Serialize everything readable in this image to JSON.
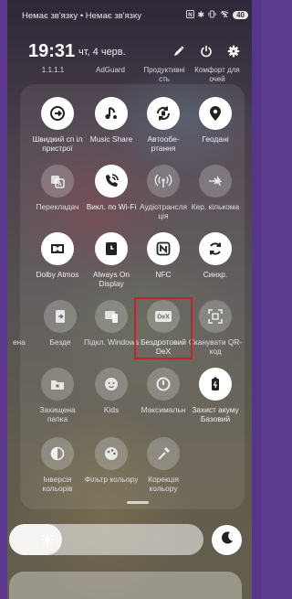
{
  "status_bar": {
    "carrier": "Немає зв'язку • Немає зв'язку",
    "battery": "40",
    "icons": [
      "nfc-icon",
      "bluetooth-icon",
      "vibrate-icon",
      "wifi-off-icon"
    ]
  },
  "header": {
    "time": "19:31",
    "date": "чт, 4 черв.",
    "icons": [
      "pencil-icon",
      "power-icon",
      "gear-icon"
    ]
  },
  "top_partial_labels": [
    "1.1.1.1",
    "AdGuard",
    "Продуктивні сть",
    "Комфорт для очей"
  ],
  "tiles": [
    {
      "label": "Швидкий сп іл пристрої",
      "state": "on",
      "icon": "quick-share-icon"
    },
    {
      "label": "Music Share",
      "state": "on",
      "icon": "music-share-icon"
    },
    {
      "label": "Автообе- ртання",
      "state": "on",
      "icon": "auto-rotate-icon"
    },
    {
      "label": "Геодані",
      "state": "on",
      "icon": "location-icon"
    },
    {
      "label": "Перекладач",
      "state": "off",
      "icon": "translate-icon"
    },
    {
      "label": "Викл. по Wi-Fi",
      "state": "on",
      "icon": "wifi-calling-icon"
    },
    {
      "label": "Аудіотрансля ція",
      "state": "off",
      "icon": "broadcast-icon"
    },
    {
      "label": "Кер. кількома",
      "state": "off",
      "icon": "multi-control-icon"
    },
    {
      "label": "Dolby Atmos",
      "state": "on",
      "icon": "dolby-icon"
    },
    {
      "label": "Always On Display",
      "state": "on",
      "icon": "aod-icon"
    },
    {
      "label": "NFC",
      "state": "on",
      "icon": "nfc-icon"
    },
    {
      "label": "Синхр.",
      "state": "on",
      "icon": "sync-icon"
    },
    {
      "label": "ена",
      "state": "off",
      "icon": "partial-icon"
    },
    {
      "label": "Безде",
      "state": "off",
      "icon": "wireless-share-icon"
    },
    {
      "label": "Підкл. Windows",
      "state": "off",
      "icon": "link-windows-icon"
    },
    {
      "label": "Бездротовий DeX",
      "state": "off",
      "icon": "dex-icon"
    },
    {
      "label": "Сканувати QR-код",
      "state": "off",
      "icon": "qr-scan-icon"
    },
    {
      "label": "Захищена папка",
      "state": "off",
      "icon": "secure-folder-icon"
    },
    {
      "label": "Kids",
      "state": "off",
      "icon": "kids-icon"
    },
    {
      "label": "Максимальн",
      "state": "off",
      "icon": "power-saving-icon"
    },
    {
      "label": "Захист акуму Базовий",
      "state": "on",
      "icon": "battery-protect-icon"
    },
    {
      "label": "Інверсія кольорів",
      "state": "off",
      "icon": "invert-colors-icon"
    },
    {
      "label": "Фільтр кольору",
      "state": "off",
      "icon": "color-filter-icon"
    },
    {
      "label": "Корекція кольору",
      "state": "off",
      "icon": "color-correction-icon"
    }
  ],
  "brightness": {
    "level": 0.27,
    "icon": "sun-icon"
  },
  "dark_mode": {
    "icon": "moon-icon"
  }
}
